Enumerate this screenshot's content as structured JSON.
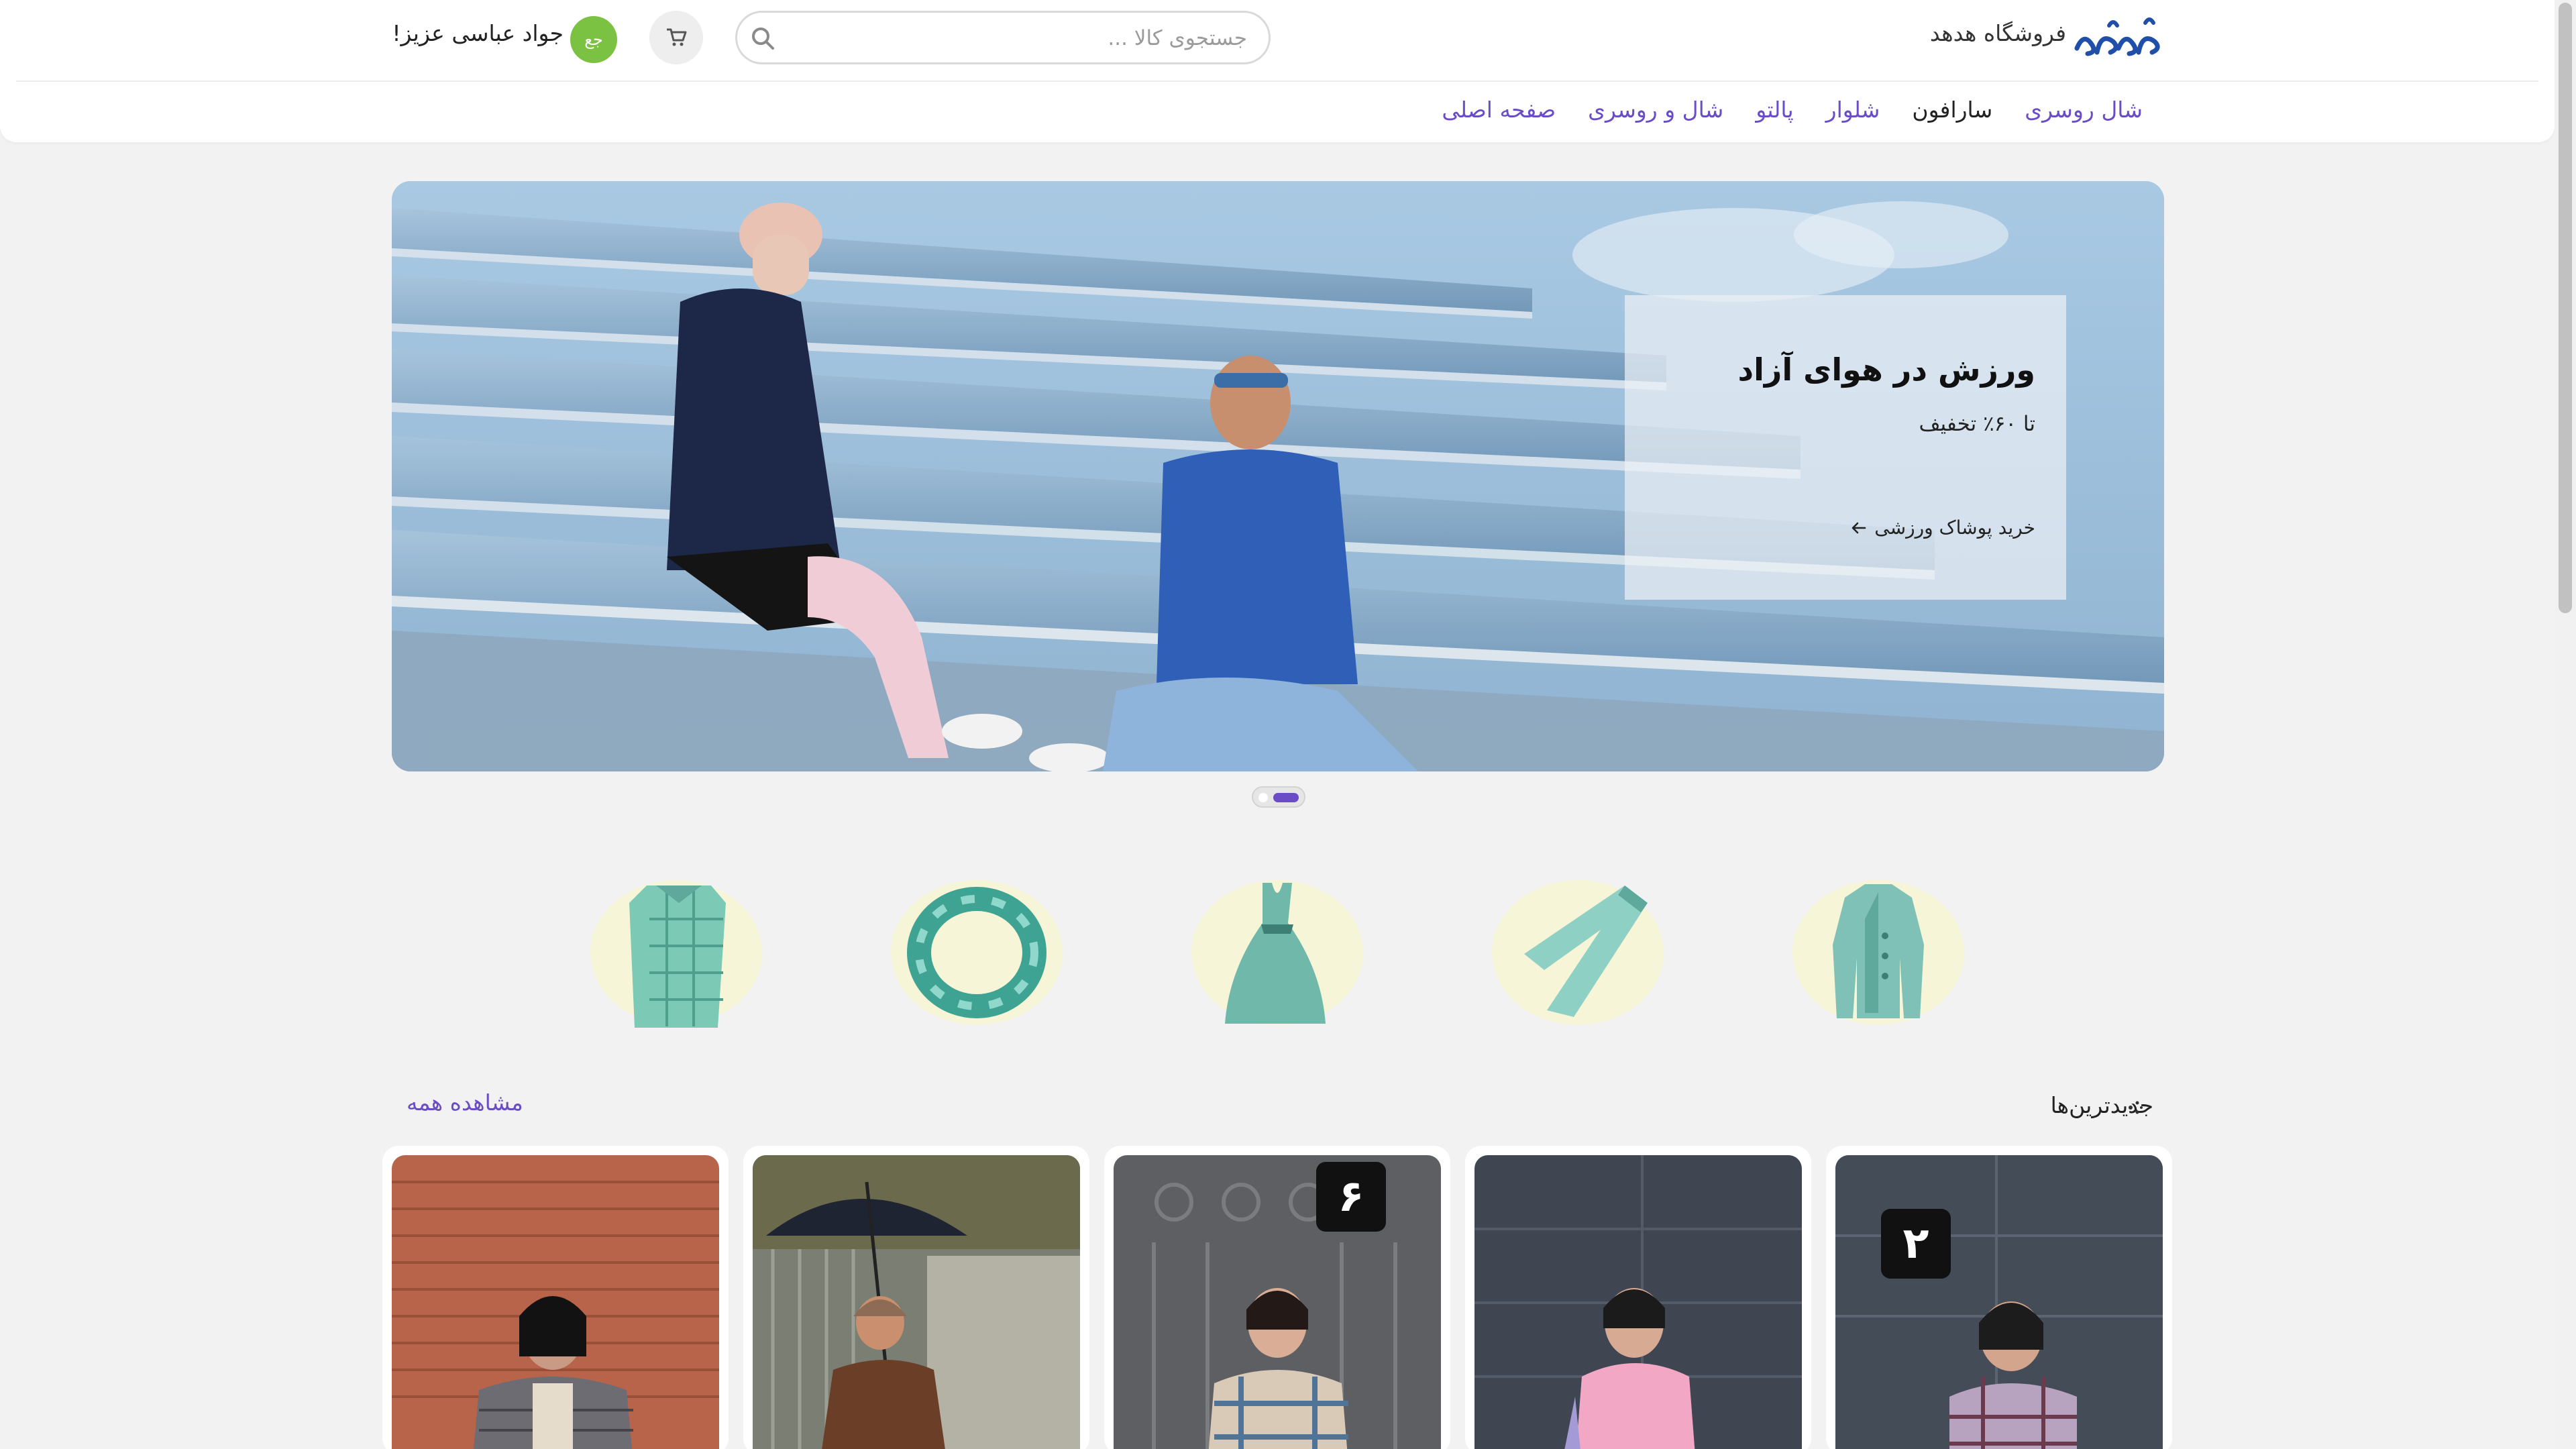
{
  "header": {
    "store_name": "فروشگاه هدهد",
    "logo_text": "هدهد",
    "search_placeholder": "جستجوی کالا ...",
    "avatar_initials": "جع",
    "greeting": "جواد عباسی عزیز!",
    "accent_color": "#6a4cc7",
    "avatar_color": "#7cc242"
  },
  "nav": {
    "items": [
      {
        "label": "صفحه اصلی",
        "active": false
      },
      {
        "label": "شال و روسری",
        "active": false
      },
      {
        "label": "پالتو",
        "active": false
      },
      {
        "label": "شلوار",
        "active": false
      },
      {
        "label": "سارافون",
        "active": true
      },
      {
        "label": "شال روسری",
        "active": false
      }
    ]
  },
  "hero": {
    "title": "ورزش در هوای آزاد",
    "subtitle": "تا ۶۰٪ تخفیف",
    "link": "خرید پوشاک ورزشی",
    "link_icon": "arrow-left-icon",
    "slide_count": 2,
    "active_slide": 1
  },
  "categories": [
    {
      "icon": "coat-icon"
    },
    {
      "icon": "pants-icon"
    },
    {
      "icon": "dress-icon"
    },
    {
      "icon": "scarf-icon"
    },
    {
      "icon": "shirt-icon"
    }
  ],
  "newest": {
    "title": "جدیدترین‌ها",
    "view_all": "مشاهده همه",
    "products": [
      {
        "badge": "۲",
        "scene": "plaid-jacket-dark-door"
      },
      {
        "badge": "",
        "scene": "pink-vest-dark-door"
      },
      {
        "badge": "۶",
        "scene": "plaid-coat-iron-gate"
      },
      {
        "badge": "",
        "scene": "umbrella-brown-coat"
      },
      {
        "badge": "",
        "scene": "check-blazer-brick-wall"
      }
    ]
  }
}
